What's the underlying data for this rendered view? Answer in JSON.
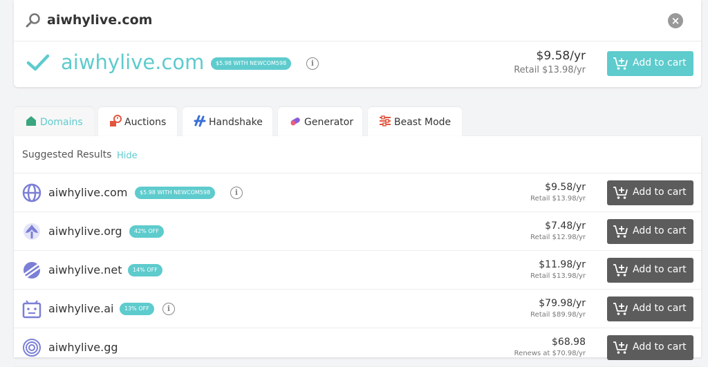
{
  "search": {
    "query": "aiwhylive.com"
  },
  "main_result": {
    "domain": "aiwhylive.com",
    "promo": "$5.98 WITH NEWCOM598",
    "price": "$9.58/yr",
    "retail": "Retail $13.98/yr",
    "cart_label": "Add to cart"
  },
  "tabs": [
    {
      "label": "Domains",
      "icon": "home-icon"
    },
    {
      "label": "Auctions",
      "icon": "auction-icon"
    },
    {
      "label": "Handshake",
      "icon": "handshake-icon"
    },
    {
      "label": "Generator",
      "icon": "generator-icon"
    },
    {
      "label": "Beast Mode",
      "icon": "sliders-icon"
    }
  ],
  "results": {
    "header": "Suggested Results",
    "hide_label": "Hide",
    "rows": [
      {
        "domain": "aiwhylive.com",
        "badge": "$5.98 WITH NEWCOM598",
        "price": "$9.58/yr",
        "retail": "Retail $13.98/yr",
        "cart_label": "Add to cart",
        "icon": "globe-icon"
      },
      {
        "domain": "aiwhylive.org",
        "badge": "42% OFF",
        "price": "$7.48/yr",
        "retail": "Retail $12.98/yr",
        "cart_label": "Add to cart",
        "icon": "org-icon"
      },
      {
        "domain": "aiwhylive.net",
        "badge": "14% OFF",
        "price": "$11.98/yr",
        "retail": "Retail $13.98/yr",
        "cart_label": "Add to cart",
        "icon": "net-icon"
      },
      {
        "domain": "aiwhylive.ai",
        "badge": "13% OFF",
        "price": "$79.98/yr",
        "retail": "Retail $89.98/yr",
        "cart_label": "Add to cart",
        "icon": "ai-icon"
      },
      {
        "domain": "aiwhylive.gg",
        "badge": "",
        "price": "$68.98",
        "retail": "Renews at $70.98/yr",
        "cart_label": "Add to cart",
        "icon": "target-icon"
      }
    ]
  },
  "colors": {
    "accent": "#5ecbcd",
    "cart_dark": "#5c5c5c",
    "tld_icon": "#7b7fd6"
  }
}
